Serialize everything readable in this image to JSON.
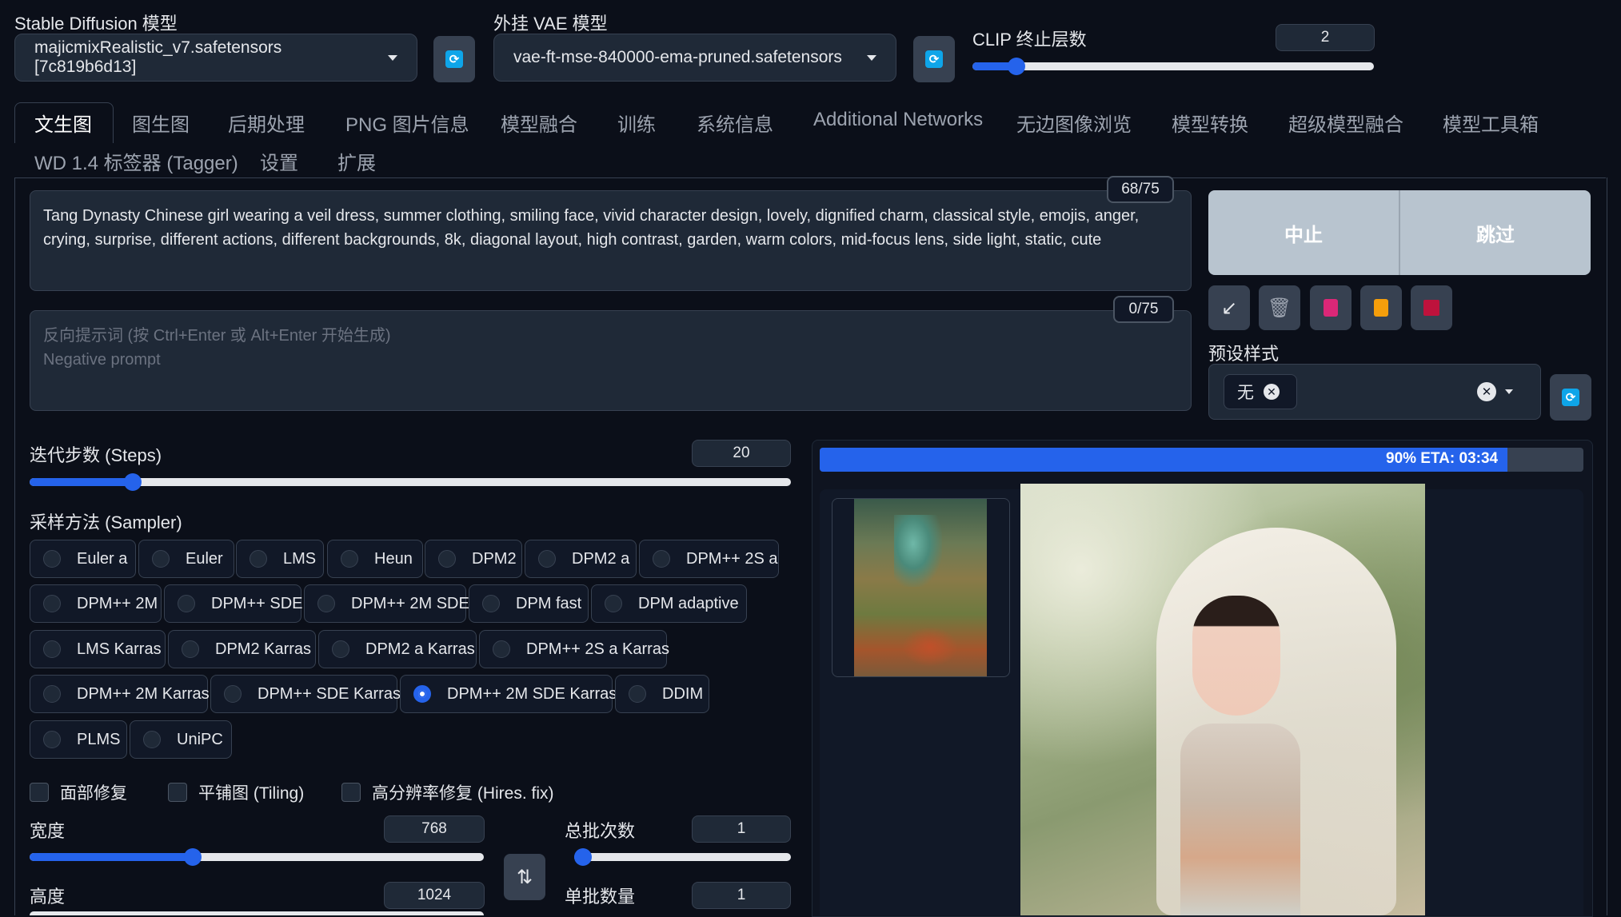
{
  "top": {
    "sd_model_label": "Stable Diffusion 模型",
    "sd_model_value": "majicmixRealistic_v7.safetensors [7c819b6d13]",
    "vae_label": "外挂 VAE 模型",
    "vae_value": "vae-ft-mse-840000-ema-pruned.safetensors",
    "clip_label": "CLIP 终止层数",
    "clip_value": "2",
    "clip_fraction": 0.11
  },
  "tabs": [
    "文生图",
    "图生图",
    "后期处理",
    "PNG 图片信息",
    "模型融合",
    "训练",
    "系统信息",
    "Additional Networks",
    "无边图像浏览",
    "模型转换",
    "超级模型融合",
    "模型工具箱",
    "WD 1.4 标签器 (Tagger)",
    "设置",
    "扩展"
  ],
  "prompt": {
    "text": "Tang Dynasty Chinese girl wearing a veil dress, summer clothing, smiling face, vivid character design, lovely, dignified charm, classical style, emojis, anger, crying, surprise, different actions, different backgrounds, 8k, diagonal layout, high contrast, garden, warm colors, mid-focus lens, side light, static, cute",
    "counter": "68/75"
  },
  "negative": {
    "placeholder_line1": "反向提示词 (按 Ctrl+Enter 或 Alt+Enter 开始生成)",
    "placeholder_line2": "Negative prompt",
    "counter": "0/75"
  },
  "actions": {
    "interrupt": "中止",
    "skip": "跳过",
    "styles_label": "预设样式",
    "style_tag": "无"
  },
  "steps": {
    "label": "迭代步数 (Steps)",
    "value": "20",
    "fraction": 0.135
  },
  "sampler": {
    "label": "采样方法 (Sampler)",
    "options": [
      "Euler a",
      "Euler",
      "LMS",
      "Heun",
      "DPM2",
      "DPM2 a",
      "DPM++ 2S a",
      "DPM++ 2M",
      "DPM++ SDE",
      "DPM++ 2M SDE",
      "DPM fast",
      "DPM adaptive",
      "LMS Karras",
      "DPM2 Karras",
      "DPM2 a Karras",
      "DPM++ 2S a Karras",
      "DPM++ 2M Karras",
      "DPM++ SDE Karras",
      "DPM++ 2M SDE Karras",
      "DDIM",
      "PLMS",
      "UniPC"
    ],
    "selected": "DPM++ 2M SDE Karras"
  },
  "checks": [
    "面部修复",
    "平铺图 (Tiling)",
    "高分辨率修复 (Hires. fix)"
  ],
  "width": {
    "label": "宽度",
    "value": "768",
    "fraction": 0.36
  },
  "height": {
    "label": "高度",
    "value": "1024"
  },
  "batch_count": {
    "label": "总批次数",
    "value": "1",
    "fraction": 0.0
  },
  "batch_size": {
    "label": "单批数量",
    "value": "1"
  },
  "progress": {
    "text": "90% ETA: 03:34",
    "fraction": 0.9
  }
}
